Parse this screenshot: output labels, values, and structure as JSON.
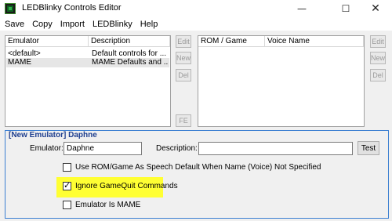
{
  "window": {
    "title": "LEDBlinky Controls Editor",
    "controls": {
      "minimize": "—",
      "maximize": "☐",
      "close": "✕"
    }
  },
  "menu": [
    "Save",
    "Copy",
    "Import",
    "LEDBlinky",
    "Help"
  ],
  "emulator_list": {
    "columns": [
      "Emulator",
      "Description"
    ],
    "rows": [
      {
        "emulator": "<default>",
        "description": "Default controls for ..."
      },
      {
        "emulator": "MAME",
        "description": "MAME Defaults and ..."
      }
    ],
    "buttons": {
      "edit": "Edit",
      "new": "New",
      "del": "Del",
      "fe": "FE"
    }
  },
  "rom_list": {
    "columns": [
      "ROM / Game",
      "Voice Name"
    ],
    "buttons": {
      "edit": "Edit",
      "new": "New",
      "del": "Del"
    }
  },
  "emulator_group": {
    "title": "[New Emulator] Daphne",
    "emulator_label": "Emulator:",
    "emulator_value": "Daphne",
    "description_label": "Description:",
    "description_value": "",
    "test_button": "Test",
    "checkboxes": [
      {
        "label": "Use ROM/Game As Speech Default When Name (Voice) Not Specified",
        "checked": false
      },
      {
        "label": "Ignore GameQuit Commands",
        "checked": true
      },
      {
        "label": "Emulator Is MAME",
        "checked": false
      }
    ],
    "highlight_color": "#ffff33"
  }
}
